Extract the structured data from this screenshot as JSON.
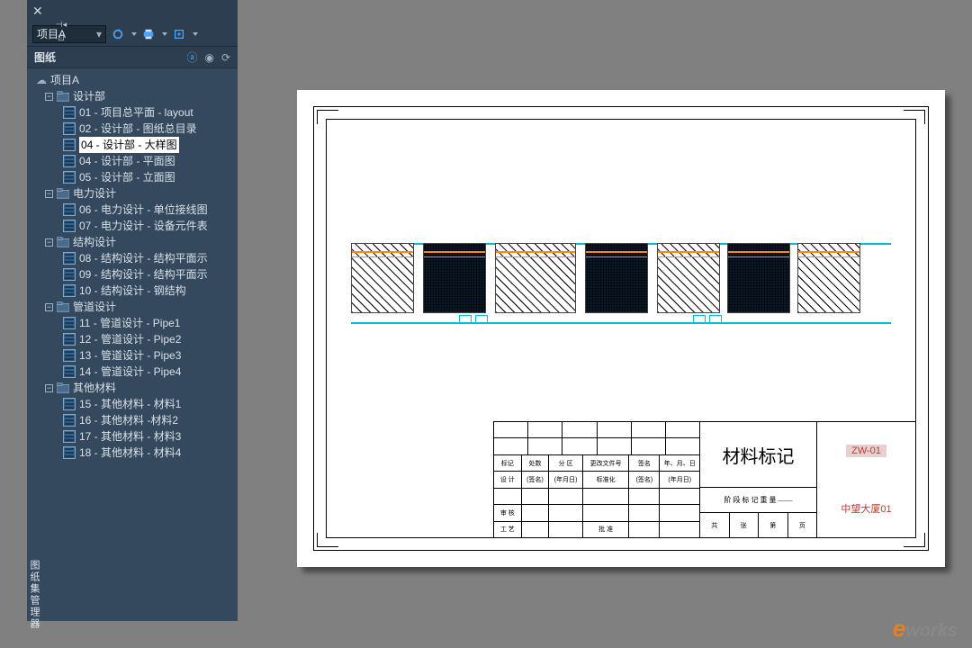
{
  "panel": {
    "project_dropdown": "项目A",
    "section_title": "图纸",
    "vertical_label": "图纸集管理器"
  },
  "tree": {
    "root": "项目A",
    "groups": [
      {
        "name": "设计部",
        "items": [
          "01 - 项目总平面 - layout",
          "02 - 设计部 - 图纸总目录",
          "04 - 设计部 - 大样图",
          "04 - 设计部 - 平面图",
          "05 - 设计部 - 立面图"
        ],
        "selected_index": 2
      },
      {
        "name": "电力设计",
        "items": [
          "06 - 电力设计 - 单位接线图",
          "07 - 电力设计 - 设备元件表"
        ]
      },
      {
        "name": "结构设计",
        "items": [
          "08 - 结构设计 - 结构平面示",
          "09 - 结构设计 - 结构平面示",
          "10 - 结构设计 - 钢结构"
        ]
      },
      {
        "name": "管道设计",
        "items": [
          "11 - 管道设计 - Pipe1",
          "12 - 管道设计 - Pipe2",
          "13 - 管道设计 - Pipe3",
          "14 - 管道设计 - Pipe4"
        ]
      },
      {
        "name": "其他材料",
        "items": [
          "15 - 其他材料 - 材料1",
          "16 - 其他材料 -材料2",
          "17 - 其他材料 - 材料3",
          "18 - 其他材料 - 材料4"
        ]
      }
    ]
  },
  "drawing": {
    "title_block": {
      "big_label": "材料标记",
      "sub_label": "阶 段 标 记   重 量   ——",
      "footer": [
        "共",
        "张",
        "第",
        "页"
      ],
      "rows_header": [
        "标记",
        "处数",
        "分 区",
        "更改文件号",
        "签名",
        "年、月、日"
      ],
      "rows": [
        [
          "设 计",
          "(签名)",
          "(年月日)",
          "标准化",
          "(签名)",
          "(年月日)"
        ],
        [
          "",
          "",
          "",
          "",
          "",
          ""
        ],
        [
          "审 核",
          "",
          "",
          "",
          "",
          ""
        ],
        [
          "工 艺",
          "",
          "",
          "批 准",
          "",
          ""
        ]
      ],
      "code1": "ZW-01",
      "code2": "中望大厦01"
    }
  },
  "watermark": "works"
}
